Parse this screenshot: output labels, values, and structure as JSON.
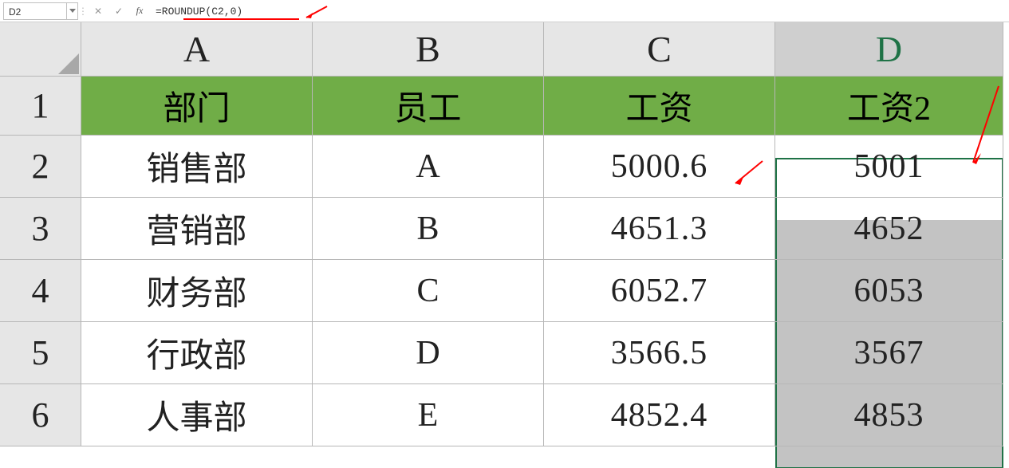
{
  "formula_bar": {
    "cell_ref": "D2",
    "cancel_icon": "✕",
    "confirm_icon": "✓",
    "fx_label": "fx",
    "formula": "=ROUNDUP(C2,0)"
  },
  "columns": [
    "A",
    "B",
    "C",
    "D"
  ],
  "row_numbers": [
    "1",
    "2",
    "3",
    "4",
    "5",
    "6"
  ],
  "headers": {
    "A": "部门",
    "B": "员工",
    "C": "工资",
    "D": "工资2"
  },
  "data": [
    {
      "A": "销售部",
      "B": "A",
      "C": "5000.6",
      "D": "5001"
    },
    {
      "A": "营销部",
      "B": "B",
      "C": "4651.3",
      "D": "4652"
    },
    {
      "A": "财务部",
      "B": "C",
      "C": "6052.7",
      "D": "6053"
    },
    {
      "A": "行政部",
      "B": "D",
      "C": "3566.5",
      "D": "3567"
    },
    {
      "A": "人事部",
      "B": "E",
      "C": "4852.4",
      "D": "4853"
    }
  ],
  "selection": {
    "range": "D2:D6",
    "active": "D2"
  },
  "colors": {
    "header_fill": "#70ad47",
    "selection_border": "#1f7246",
    "annotation": "#ff0000"
  },
  "chart_data": {
    "type": "table",
    "title": "",
    "columns": [
      "部门",
      "员工",
      "工资",
      "工资2"
    ],
    "rows": [
      [
        "销售部",
        "A",
        5000.6,
        5001
      ],
      [
        "营销部",
        "B",
        4651.3,
        4652
      ],
      [
        "财务部",
        "C",
        6052.7,
        6053
      ],
      [
        "行政部",
        "D",
        3566.5,
        3567
      ],
      [
        "人事部",
        "E",
        4852.4,
        4853
      ]
    ],
    "formula_column_D": "=ROUNDUP(C_row,0)"
  }
}
